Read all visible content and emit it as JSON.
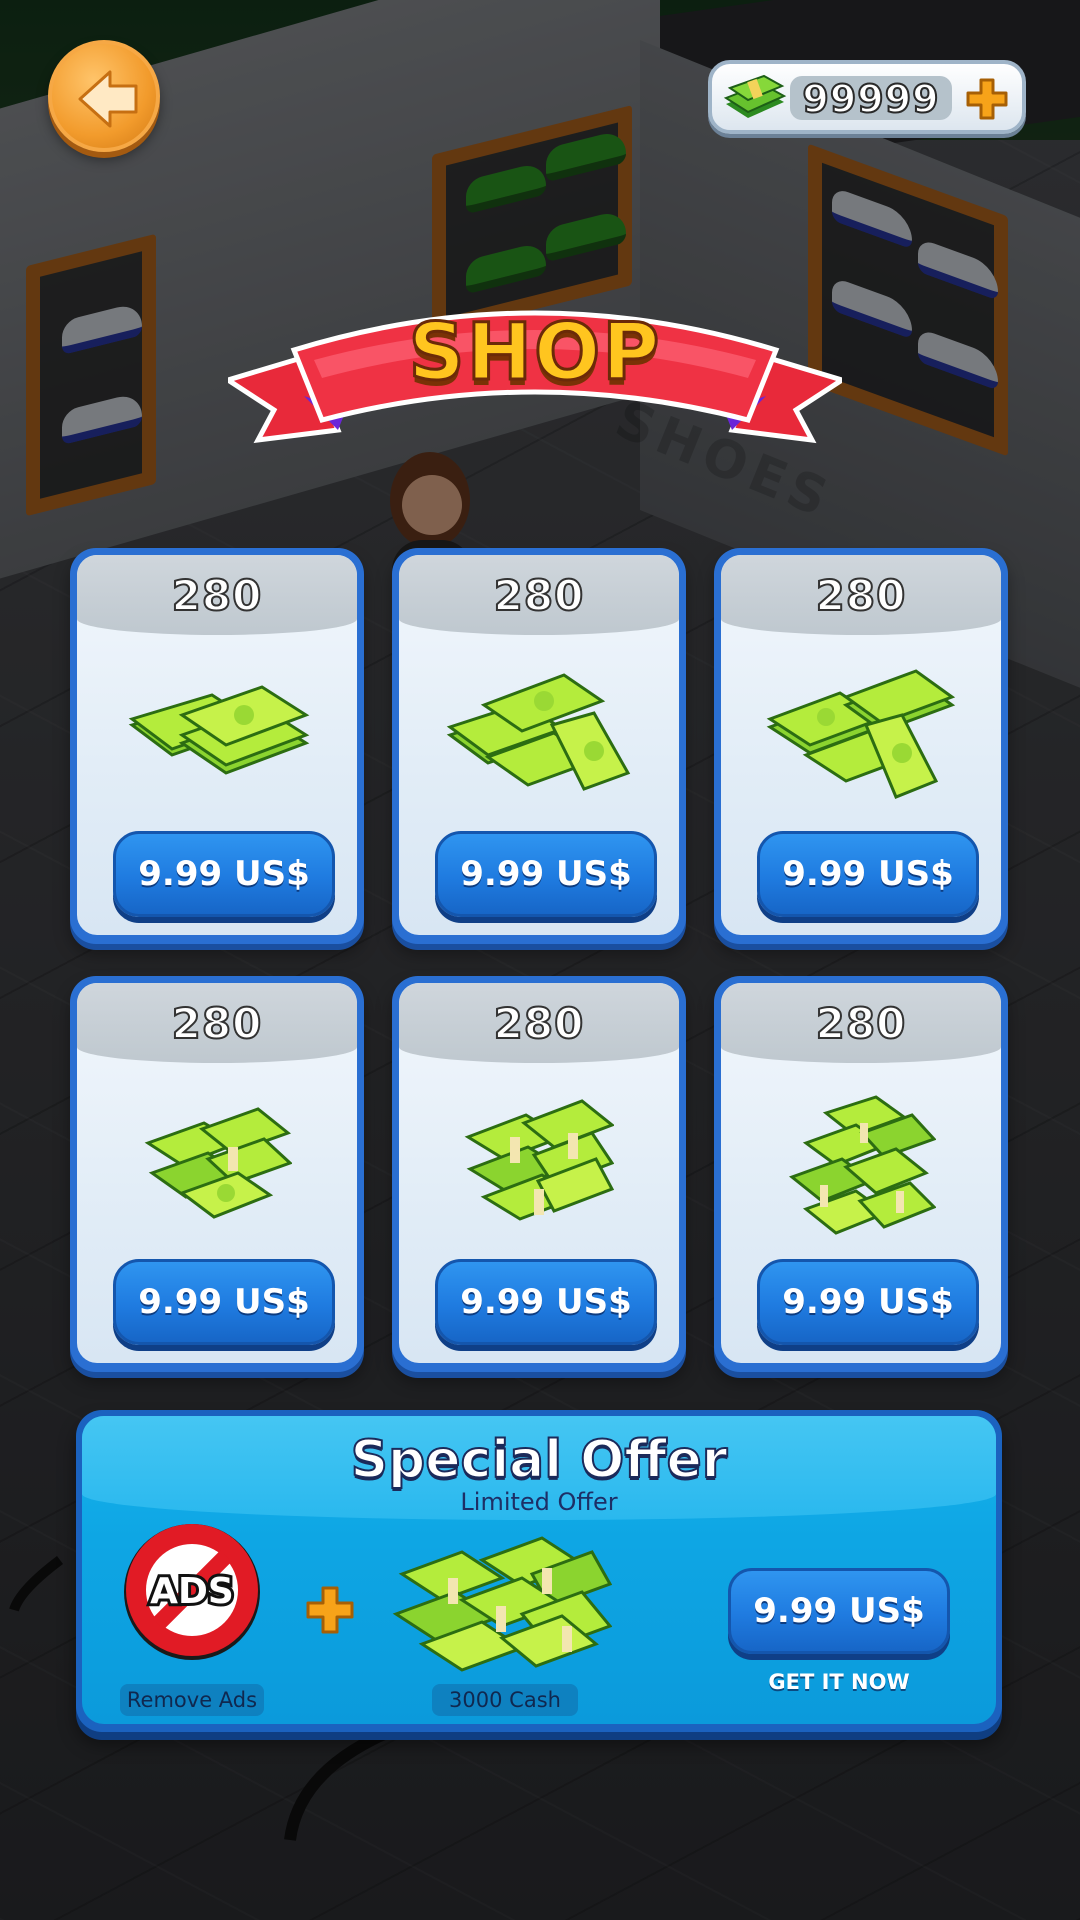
{
  "header": {
    "back_icon": "back-arrow-icon",
    "currency": {
      "icon": "cash-stack-icon",
      "value": "99999",
      "add_icon": "plus-icon"
    }
  },
  "banner": {
    "title": "SHOP"
  },
  "background": {
    "floor_text": "SHOES"
  },
  "products": [
    {
      "amount": "280",
      "price": "9.99 US$",
      "art": "cash-small-icon"
    },
    {
      "amount": "280",
      "price": "9.99 US$",
      "art": "cash-medium-icon"
    },
    {
      "amount": "280",
      "price": "9.99 US$",
      "art": "cash-large-icon"
    },
    {
      "amount": "280",
      "price": "9.99 US$",
      "art": "cash-bundle-icon"
    },
    {
      "amount": "280",
      "price": "9.99 US$",
      "art": "cash-bigbundle-icon"
    },
    {
      "amount": "280",
      "price": "9.99 US$",
      "art": "cash-pile-icon"
    }
  ],
  "special_offer": {
    "title": "Special Offer",
    "subtitle": "Limited Offer",
    "no_ads_text": "ADS",
    "remove_ads_label": "Remove Ads",
    "cash_label": "3000 Cash",
    "price": "9.99 US$",
    "cta": "GET IT NOW"
  },
  "colors": {
    "card_blue": "#2a6fd2",
    "button_blue": "#1f7be0",
    "banner_red": "#e8293a",
    "gold": "#ffc51f",
    "offer_cyan": "#0ea6e4"
  }
}
